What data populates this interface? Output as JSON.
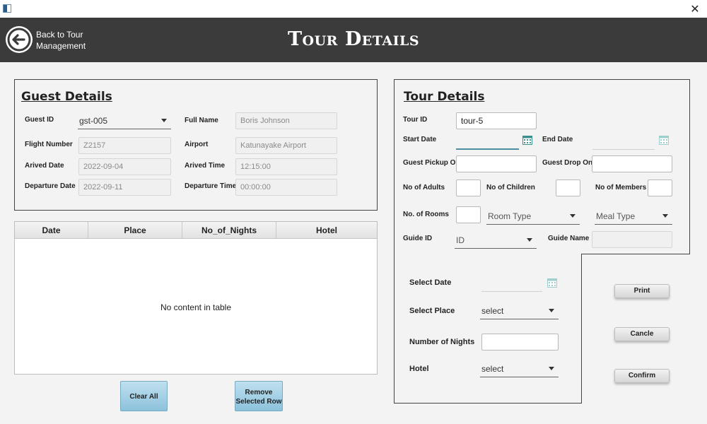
{
  "window": {
    "close_glyph": "✕"
  },
  "header": {
    "back_label_line1": "Back to Tour",
    "back_label_line2": "Management",
    "title": "Tour Details"
  },
  "guest": {
    "title": "Guest Details",
    "guest_id_label": "Guest ID",
    "guest_id_value": "gst-005",
    "full_name_label": "Full Name",
    "full_name_value": "Boris Johnson",
    "flight_number_label": "Flight Number",
    "flight_number_value": "Z2157",
    "airport_label": "Airport",
    "airport_value": "Katunayake Airport",
    "arrived_date_label": "Arived Date",
    "arrived_date_value": "2022-09-04",
    "arrived_time_label": "Arived Time",
    "arrived_time_value": "12:15:00",
    "departure_date_label": "Departure Date",
    "departure_date_value": "2022-09-11",
    "departure_time_label": "Departure Time",
    "departure_time_value": "00:00:00"
  },
  "table": {
    "columns": [
      "Date",
      "Place",
      "No_of_Nights",
      "Hotel"
    ],
    "empty_message": "No content in table"
  },
  "buttons": {
    "clear_all": "Clear All",
    "remove_line1": "Remove",
    "remove_line2": "Selected Row",
    "print": "Print",
    "cancel": "Cancle",
    "confirm": "Confirm"
  },
  "tour": {
    "title": "Tour Details",
    "tour_id_label": "Tour ID",
    "tour_id_value": "tour-5",
    "start_date_label": "Start Date",
    "end_date_label": "End Date",
    "pickup_label": "Guest Pickup On",
    "drop_label": "Guest Drop On",
    "adults_label": "No of Adults",
    "children_label": "No of Children",
    "members_label": "No of Members",
    "rooms_label": "No. of Rooms",
    "room_type_placeholder": "Room Type",
    "meal_type_placeholder": "Meal Type",
    "guide_id_label": "Guide ID",
    "guide_id_placeholder": "ID",
    "guide_name_label": "Guide Name"
  },
  "itinerary": {
    "select_date_label": "Select Date",
    "select_place_label": "Select Place",
    "select_place_value": "select",
    "nights_label": "Number of Nights",
    "hotel_label": "Hotel",
    "hotel_value": "select"
  },
  "colors": {
    "header_bg": "#3b3b3b",
    "accent": "#4a9fa5",
    "button_blue": "#9fcde3"
  }
}
